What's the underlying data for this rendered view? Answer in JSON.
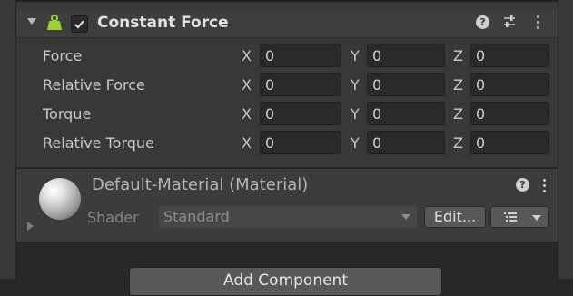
{
  "component": {
    "title": "Constant Force",
    "enabled": true,
    "icons": [
      "foldout-arrow-icon",
      "constant-force-weight-icon",
      "help-icon",
      "preset-sliders-icon",
      "kebab-menu-icon"
    ],
    "axis_labels": {
      "x": "X",
      "y": "Y",
      "z": "Z"
    },
    "rows": [
      {
        "label": "Force",
        "x": "0",
        "y": "0",
        "z": "0"
      },
      {
        "label": "Relative Force",
        "x": "0",
        "y": "0",
        "z": "0"
      },
      {
        "label": "Torque",
        "x": "0",
        "y": "0",
        "z": "0"
      },
      {
        "label": "Relative Torque",
        "x": "0",
        "y": "0",
        "z": "0"
      }
    ]
  },
  "material": {
    "title": "Default-Material (Material)",
    "shader_label": "Shader",
    "shader_value": "Standard",
    "edit_label": "Edit...",
    "icons": [
      "material-sphere-icon",
      "help-icon",
      "kebab-menu-icon",
      "list-icon"
    ]
  },
  "add_component": {
    "label": "Add Component"
  },
  "colors": {
    "panel": "#383838",
    "header": "#3e3e3e",
    "field": "#2a2a2a",
    "accent_green": "#9bd131",
    "background": "#282828"
  }
}
